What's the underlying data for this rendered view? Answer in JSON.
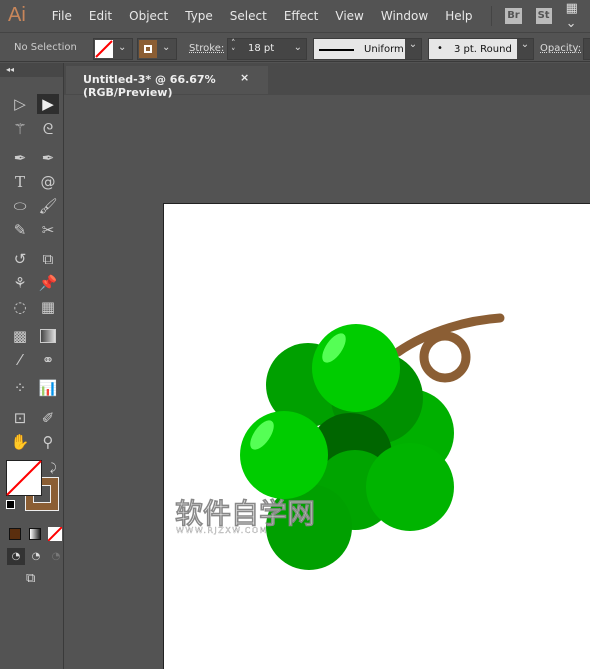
{
  "app": {
    "logo": "Ai",
    "menu": [
      "File",
      "Edit",
      "Object",
      "Type",
      "Select",
      "Effect",
      "View",
      "Window",
      "Help"
    ],
    "bridge": "Br",
    "stock": "St"
  },
  "control": {
    "selection": "No Selection",
    "stroke_label": "Stroke:",
    "stroke_value": "18 pt",
    "profile": "Uniform",
    "brush": "3 pt. Round",
    "opacity_label": "Opacity:",
    "fill_color": "#ffffff",
    "stroke_color": "#8b5e34"
  },
  "document": {
    "tab_title": "Untitled-3* @ 66.67% (RGB/Preview)",
    "close": "×"
  },
  "colors": {
    "stem": "#8b5e34",
    "grape_light": "#00cc00",
    "grape_mid": "#00aa00",
    "grape_dark": "#006600"
  },
  "watermark": {
    "cn": "软件自学网",
    "url": "WWW.RJZXW.COM"
  },
  "tools": [
    "selection",
    "direct-selection",
    "magic-wand",
    "lasso",
    "pen",
    "curvature",
    "type",
    "spiral",
    "ellipse",
    "paintbrush",
    "shaper",
    "scissors",
    "rotate",
    "scale",
    "puppet-warp",
    "pin",
    "shape-builder",
    "perspective-grid",
    "mesh",
    "gradient",
    "eyedropper",
    "blend",
    "symbol-sprayer",
    "column-graph",
    "artboard",
    "slice",
    "hand",
    "zoom"
  ]
}
